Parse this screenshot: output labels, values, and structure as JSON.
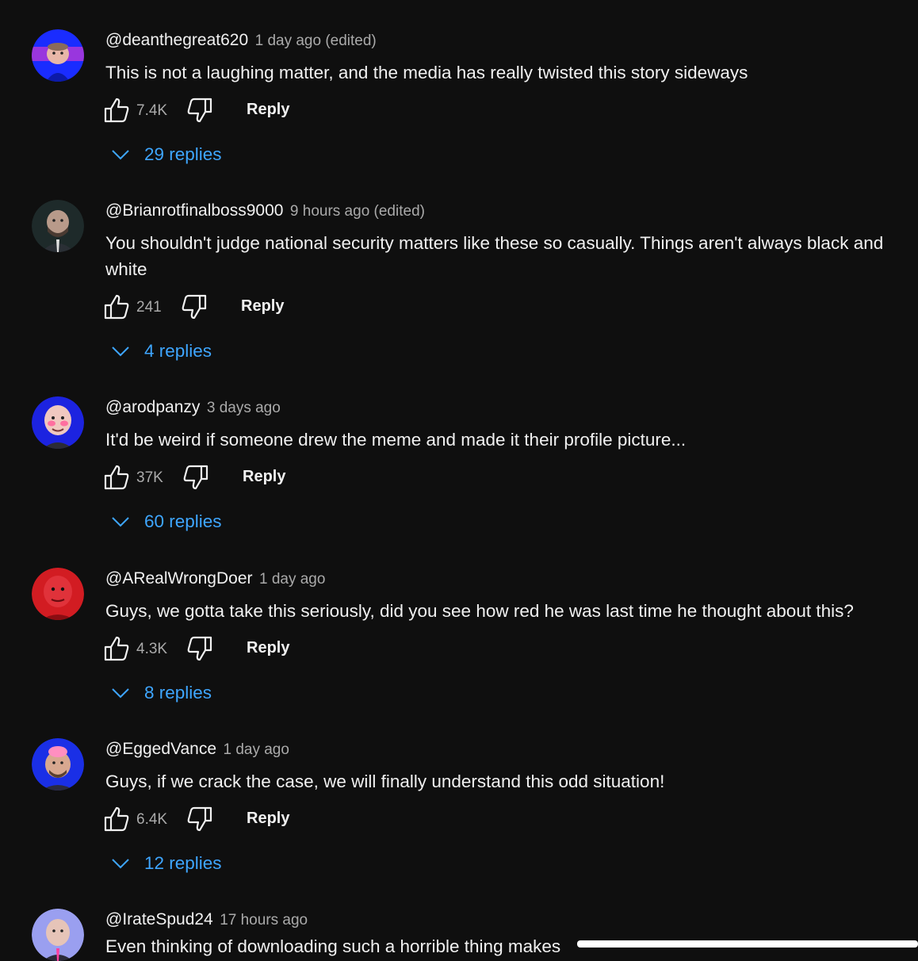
{
  "comments": [
    {
      "handle": "@deanthegreat620",
      "time": "1 day ago (edited)",
      "text": "This is not a laughing matter, and the media has really twisted this story sideways",
      "likes": "7.4K",
      "reply_label": "Reply",
      "replies": "29 replies",
      "avatar_bg": "#1a2cff"
    },
    {
      "handle": "@Brianrotfinalboss9000",
      "time": "9 hours ago (edited)",
      "text": "You shouldn't judge national security matters like these so casually. Things aren't always black and white",
      "likes": "241",
      "reply_label": "Reply",
      "replies": "4 replies",
      "avatar_bg": "#1e2a2a"
    },
    {
      "handle": "@arodpanzy",
      "time": "3 days ago",
      "text": "It'd be weird if someone drew the meme and made it their profile picture...",
      "likes": "37K",
      "reply_label": "Reply",
      "replies": "60 replies",
      "avatar_bg": "#1c23e0"
    },
    {
      "handle": "@ARealWrongDoer",
      "time": "1 day ago",
      "text": "Guys, we gotta take this seriously, did you see how red he was last time he thought about this?",
      "likes": "4.3K",
      "reply_label": "Reply",
      "replies": "8 replies",
      "avatar_bg": "#d21c22"
    },
    {
      "handle": "@EggedVance",
      "time": "1 day ago",
      "text": "Guys, if we crack the case, we will finally understand this odd situation!",
      "likes": "6.4K",
      "reply_label": "Reply",
      "replies": "12 replies",
      "avatar_bg": "#1a2fe6"
    },
    {
      "handle": "@IrateSpud24",
      "time": "17 hours ago",
      "text": "Even thinking of downloading such a horrible thing makes",
      "avatar_bg": "#9a9ff0"
    }
  ],
  "colors": {
    "background": "#0f0f0f",
    "link": "#3ea6ff",
    "secondary_text": "#aaaaaa"
  }
}
